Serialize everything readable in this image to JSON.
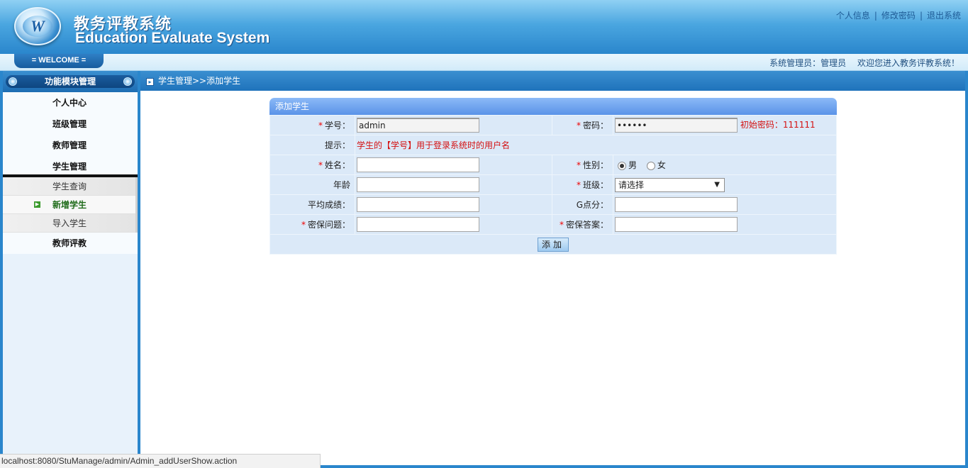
{
  "header": {
    "logo_letter": "W",
    "title_cn": "教务评教系统",
    "title_en": "Education Evaluate System",
    "links": [
      "个人信息",
      "修改密码",
      "退出系统"
    ]
  },
  "welcome": {
    "tab_label": "= WELCOME =",
    "role_label": "系统管理员：管理员",
    "greeting": "欢迎您进入教务评教系统！"
  },
  "sidebar": {
    "header": "功能模块管理",
    "items": [
      "个人中心",
      "班级管理",
      "教师管理",
      "学生管理"
    ],
    "sub_items": [
      "学生查询",
      "新增学生",
      "导入学生"
    ],
    "active_sub": "新增学生",
    "after_items": [
      "教师评教"
    ]
  },
  "breadcrumb": "学生管理>>添加学生",
  "form": {
    "title": "添加学生",
    "student_id_label": "学号：",
    "student_id_value": "admin",
    "password_label": "密码：",
    "password_value": "••••••",
    "password_hint": "初始密码：111111",
    "tip_label": "提示：",
    "tip_text": "学生的【学号】用于登录系统时的用户名",
    "name_label": "姓名：",
    "gender_label": "性别：",
    "gender_male": "男",
    "gender_female": "女",
    "age_label": "年龄",
    "class_label": "班级：",
    "class_selected": "请选择",
    "avg_score_label": "平均成绩：",
    "g_points_label": "G点分：",
    "security_question_label": "密保问题：",
    "security_answer_label": "密保答案：",
    "submit_label": "添加"
  },
  "status_bar": "localhost:8080/StuManage/admin/Admin_addUserShow.action"
}
